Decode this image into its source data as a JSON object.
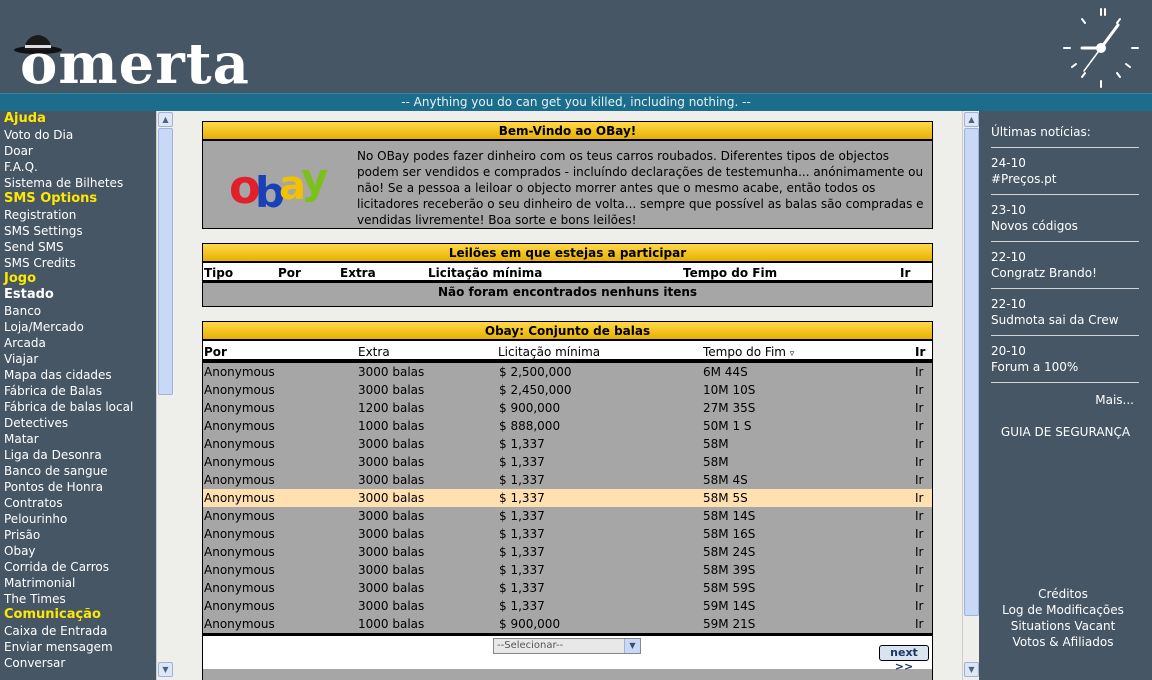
{
  "header": {
    "logo_text": "omerta",
    "tagline": "-- Anything you do can get you killed, including nothing. --"
  },
  "nav": [
    {
      "label": "Ajuda",
      "style": "yellow"
    },
    {
      "label": "Voto do Dia",
      "style": "normal"
    },
    {
      "label": "Doar",
      "style": "normal"
    },
    {
      "label": "F.A.Q.",
      "style": "normal"
    },
    {
      "label": "Sistema de Bilhetes",
      "style": "normal"
    },
    {
      "label": "SMS Options",
      "style": "yellow"
    },
    {
      "label": "Registration",
      "style": "normal"
    },
    {
      "label": "SMS Settings",
      "style": "normal"
    },
    {
      "label": "Send SMS",
      "style": "normal"
    },
    {
      "label": "SMS Credits",
      "style": "normal"
    },
    {
      "label": "Jogo",
      "style": "yellow"
    },
    {
      "label": "Estado",
      "style": "white-bold"
    },
    {
      "label": "Banco",
      "style": "normal"
    },
    {
      "label": "Loja/Mercado",
      "style": "normal"
    },
    {
      "label": "Arcada",
      "style": "normal"
    },
    {
      "label": "Viajar",
      "style": "normal"
    },
    {
      "label": "Mapa das cidades",
      "style": "normal"
    },
    {
      "label": "Fábrica de Balas",
      "style": "normal"
    },
    {
      "label": "Fábrica de balas local",
      "style": "normal"
    },
    {
      "label": "Detectives",
      "style": "normal"
    },
    {
      "label": "Matar",
      "style": "normal"
    },
    {
      "label": "Liga da Desonra",
      "style": "normal"
    },
    {
      "label": "Banco de sangue",
      "style": "normal"
    },
    {
      "label": "Pontos de Honra",
      "style": "normal"
    },
    {
      "label": "Contratos",
      "style": "normal"
    },
    {
      "label": "Pelourinho",
      "style": "normal"
    },
    {
      "label": "Prisão",
      "style": "normal"
    },
    {
      "label": "Obay",
      "style": "normal"
    },
    {
      "label": "Corrida de Carros",
      "style": "normal"
    },
    {
      "label": "Matrimonial",
      "style": "normal"
    },
    {
      "label": "The Times",
      "style": "normal"
    },
    {
      "label": "Comunicação",
      "style": "yellow"
    },
    {
      "label": "Caixa de Entrada",
      "style": "normal"
    },
    {
      "label": "Enviar mensagem",
      "style": "normal"
    },
    {
      "label": "Conversar",
      "style": "normal"
    }
  ],
  "welcome": {
    "title": "Bem-Vindo ao OBay!",
    "text": "No OBay podes fazer dinheiro com os teus carros roubados. Diferentes tipos de objectos podem ser vendidos e comprados - incluíndo declarações de testemunha... anónimamente ou não! Se a pessoa a leiloar o objecto morrer antes que o mesmo acabe, então todos os licitadores receberão o seu dinheiro de volta... sempre que possível as balas são compradas e vendidas livremente! Boa sorte e bons leilões!"
  },
  "auctions": {
    "title": "Leilões em que estejas a participar",
    "columns": [
      "Tipo",
      "Por",
      "Extra",
      "Licitação mínima",
      "Tempo do Fim",
      "Ir"
    ],
    "empty_text": "Não foram encontrados nenhuns itens"
  },
  "bullets": {
    "title": "Obay: Conjunto de balas",
    "columns": [
      "Por",
      "Extra",
      "Licitação mínima",
      "Tempo do Fim",
      "Ir"
    ],
    "sort_indicator": "▿",
    "rows": [
      [
        "Anonymous",
        "3000 balas",
        "$ 2,500,000",
        "6M 44S",
        "Ir"
      ],
      [
        "Anonymous",
        "3000 balas",
        "$ 2,450,000",
        "10M 10S",
        "Ir"
      ],
      [
        "Anonymous",
        "1200 balas",
        "$ 900,000",
        "27M 35S",
        "Ir"
      ],
      [
        "Anonymous",
        "1000 balas",
        "$ 888,000",
        "50M 1 S",
        "Ir"
      ],
      [
        "Anonymous",
        "3000 balas",
        "$ 1,337",
        "58M",
        "Ir"
      ],
      [
        "Anonymous",
        "3000 balas",
        "$ 1,337",
        "58M",
        "Ir"
      ],
      [
        "Anonymous",
        "3000 balas",
        "$ 1,337",
        "58M 4S",
        "Ir"
      ],
      [
        "Anonymous",
        "3000 balas",
        "$ 1,337",
        "58M 5S",
        "Ir"
      ],
      [
        "Anonymous",
        "3000 balas",
        "$ 1,337",
        "58M 14S",
        "Ir"
      ],
      [
        "Anonymous",
        "3000 balas",
        "$ 1,337",
        "58M 16S",
        "Ir"
      ],
      [
        "Anonymous",
        "3000 balas",
        "$ 1,337",
        "58M 24S",
        "Ir"
      ],
      [
        "Anonymous",
        "3000 balas",
        "$ 1,337",
        "58M 39S",
        "Ir"
      ],
      [
        "Anonymous",
        "3000 balas",
        "$ 1,337",
        "58M 59S",
        "Ir"
      ],
      [
        "Anonymous",
        "3000 balas",
        "$ 1,337",
        "59M 14S",
        "Ir"
      ],
      [
        "Anonymous",
        "1000 balas",
        "$ 900,000",
        "59M 21S",
        "Ir"
      ]
    ],
    "highlighted_row": 7,
    "select_placeholder": "--Selecionar--",
    "next_label": "next >>"
  },
  "news": {
    "title": "Últimas notícias:",
    "items": [
      {
        "date": "24-10",
        "text": "#Preços.pt"
      },
      {
        "date": "23-10",
        "text": "Novos códigos"
      },
      {
        "date": "22-10",
        "text": "Congratz Brando!"
      },
      {
        "date": "22-10",
        "text": "Sudmota sai da Crew"
      },
      {
        "date": "20-10",
        "text": "Forum a 100%"
      }
    ],
    "more": "Mais...",
    "safety": "GUIA DE SEGURANÇA"
  },
  "footer_links": [
    "Créditos",
    "Log de Modificações",
    "Situations Vacant",
    "Votos & Afiliados"
  ],
  "colors": {
    "background": "#465665",
    "tagline_bar": "#1c6c8c",
    "panel_title_gold": "#e8b000",
    "row_gray": "#a6a6a6",
    "row_highlight": "#ffe0b0",
    "nav_section_yellow": "#ffe800"
  }
}
